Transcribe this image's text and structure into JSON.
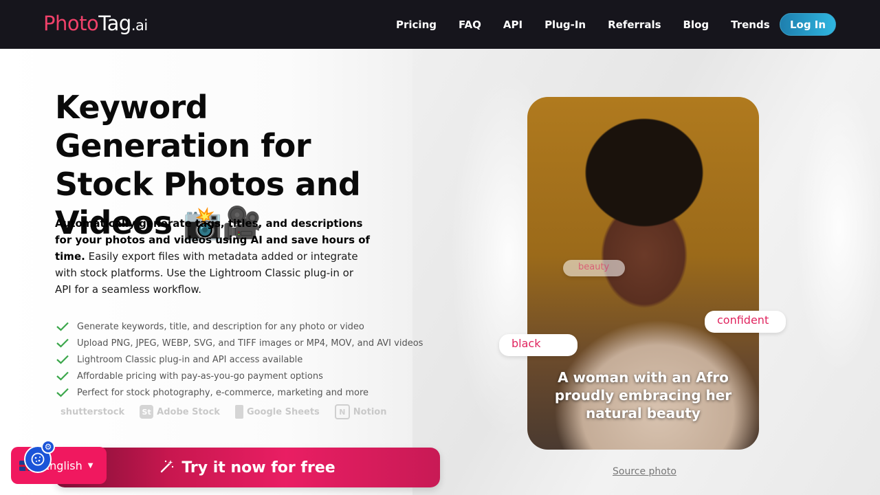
{
  "nav": {
    "logo_part1": "Photo",
    "logo_part2": "Tag",
    "logo_part3": ".ai",
    "links": [
      "Pricing",
      "FAQ",
      "API",
      "Plug-In",
      "Referrals",
      "Blog",
      "Trends"
    ],
    "login": "Log In"
  },
  "hero": {
    "headline": "Keyword Generation for Stock Photos and Videos 📸🎥",
    "intro_bold": "Automatically generate tags, titles, and descriptions for your photos and videos using AI and save hours of time.",
    "intro_rest": " Easily export files with metadata added or integrate with stock platforms. Use the Lightroom Classic plug-in or API for a seamless workflow.",
    "features": [
      "Generate keywords, title, and description for any photo or video",
      "Upload PNG, JPEG, WEBP, SVG, and TIFF images or MP4, MOV, and AVI videos",
      "Lightroom Classic plug-in and API access available",
      "Affordable pricing with pay-as-you-go payment options",
      "Perfect for stock photography, e-commerce, marketing and more"
    ],
    "partners": [
      "shutterstock",
      "Adobe Stock",
      "Google Sheets",
      "Notion"
    ],
    "cta": "Try it now for free"
  },
  "photo": {
    "caption": "A woman with an Afro proudly embracing her natural beauty",
    "tags": [
      "beauty",
      "confident",
      "black"
    ],
    "source_link": "Source photo"
  },
  "language": {
    "selected": "English"
  },
  "colors": {
    "nav_bg": "#16151c",
    "brand_pink": "#f0416a",
    "cta": "#e91e63",
    "login": "#2fb6e0",
    "check": "#3aa64a"
  }
}
